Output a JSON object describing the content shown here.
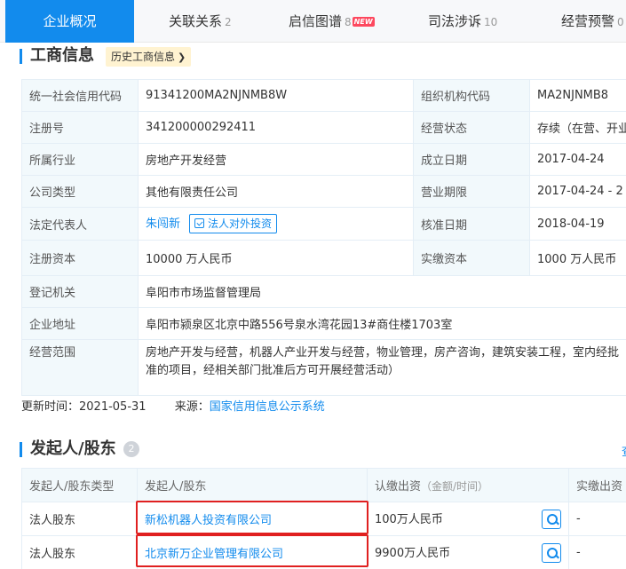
{
  "tabs": [
    {
      "label": "企业概况",
      "count": ""
    },
    {
      "label": "关联关系",
      "count": "2"
    },
    {
      "label": "启信图谱",
      "count": "8",
      "badge": "NEW"
    },
    {
      "label": "司法涉诉",
      "count": "10"
    },
    {
      "label": "经营预警",
      "count": "0"
    }
  ],
  "business_info": {
    "title": "工商信息",
    "history_tag": "历史工商信息",
    "rows": {
      "credit_code": {
        "label": "统一社会信用代码",
        "value": "91341200MA2NJNMB8W"
      },
      "org_code": {
        "label": "组织机构代码",
        "value": "MA2NJNMB8"
      },
      "reg_no": {
        "label": "注册号",
        "value": "341200000292411"
      },
      "status": {
        "label": "经营状态",
        "value": "存续（在营、开业）"
      },
      "industry": {
        "label": "所属行业",
        "value": "房地产开发经营"
      },
      "founded": {
        "label": "成立日期",
        "value": "2017-04-24"
      },
      "company_type": {
        "label": "公司类型",
        "value": "其他有限责任公司"
      },
      "term": {
        "label": "营业期限",
        "value": "2017-04-24 - 2"
      },
      "legal_rep": {
        "label": "法定代表人",
        "value": "朱闯新",
        "invest_button": "法人对外投资"
      },
      "approved": {
        "label": "核准日期",
        "value": "2018-04-19"
      },
      "reg_capital": {
        "label": "注册资本",
        "value": "10000 万人民币"
      },
      "paid_capital": {
        "label": "实缴资本",
        "value": "1000 万人民币"
      },
      "authority": {
        "label": "登记机关",
        "value": "阜阳市市场监督管理局"
      },
      "address": {
        "label": "企业地址",
        "value": "阜阳市颍泉区北京中路556号泉水湾花园13#商住楼1703室"
      },
      "scope": {
        "label": "经营范围",
        "value": "房地产开发与经营，机器人产业开发与经营，物业管理，房产咨询，建筑安装工程，室内经批准的项目，经相关部门批准后方可开展经营活动）"
      }
    },
    "update_label": "更新时间：",
    "update_time": "2021-05-31",
    "source_label": "来源：",
    "source": "国家信用信息公示系统"
  },
  "shareholders": {
    "title": "发起人/股东",
    "count": "2",
    "more_link": "查",
    "headers": {
      "type": "发起人/股东类型",
      "name": "发起人/股东",
      "subscribed": "认缴出资",
      "subscribed_sub": "（金额/时间）",
      "paid": "实缴出资"
    },
    "rows": [
      {
        "type": "法人股东",
        "name": "新松机器人投资有限公司",
        "amount": "100万人民币",
        "paid": "-"
      },
      {
        "type": "法人股东",
        "name": "北京新万企业管理有限公司",
        "amount": "9900万人民币",
        "paid": "-"
      }
    ]
  },
  "colors": {
    "accent": "#128bed",
    "highlight": "#e02020",
    "tag_bg": "#fff3d1",
    "new_badge": "#fd485e"
  }
}
